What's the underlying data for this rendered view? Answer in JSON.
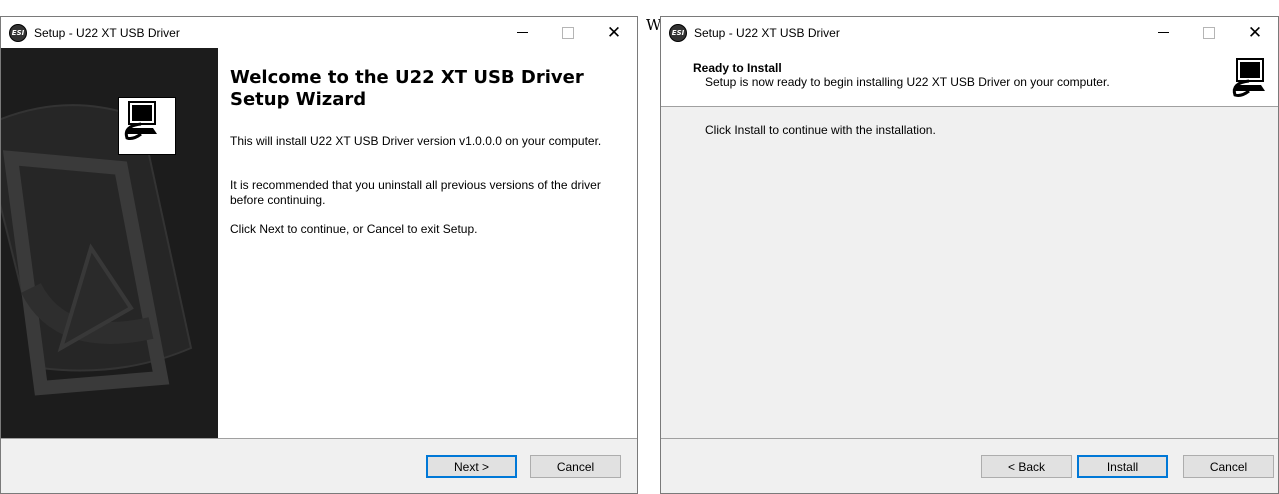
{
  "top_strip": {
    "left_text": "",
    "right_text": ""
  },
  "window1": {
    "title": "Setup - U22 XT USB Driver",
    "app_icon_text": "ESI",
    "welcome_title": "Welcome to the U22 XT USB Driver Setup Wizard",
    "paragraphs": [
      "This will install U22 XT USB Driver version v1.0.0.0 on your computer.",
      "It is recommended that you uninstall all previous versions of the driver before continuing.",
      "Click Next to continue, or Cancel to exit Setup."
    ],
    "buttons": {
      "next": "Next >",
      "cancel": "Cancel"
    }
  },
  "window2": {
    "prefix_char": "W",
    "title": "Setup - U22 XT USB Driver",
    "app_icon_text": "ESI",
    "header_title": "Ready to Install",
    "header_subtitle": "Setup is now ready to begin installing U22 XT USB Driver on your computer.",
    "content_text": "Click Install to continue with the installation.",
    "buttons": {
      "back": "< Back",
      "install": "Install",
      "cancel": "Cancel"
    }
  },
  "colors": {
    "window_bg": "#f0f0f0",
    "side_panel": "#1e1e1e",
    "default_button_border": "#0078d7"
  }
}
